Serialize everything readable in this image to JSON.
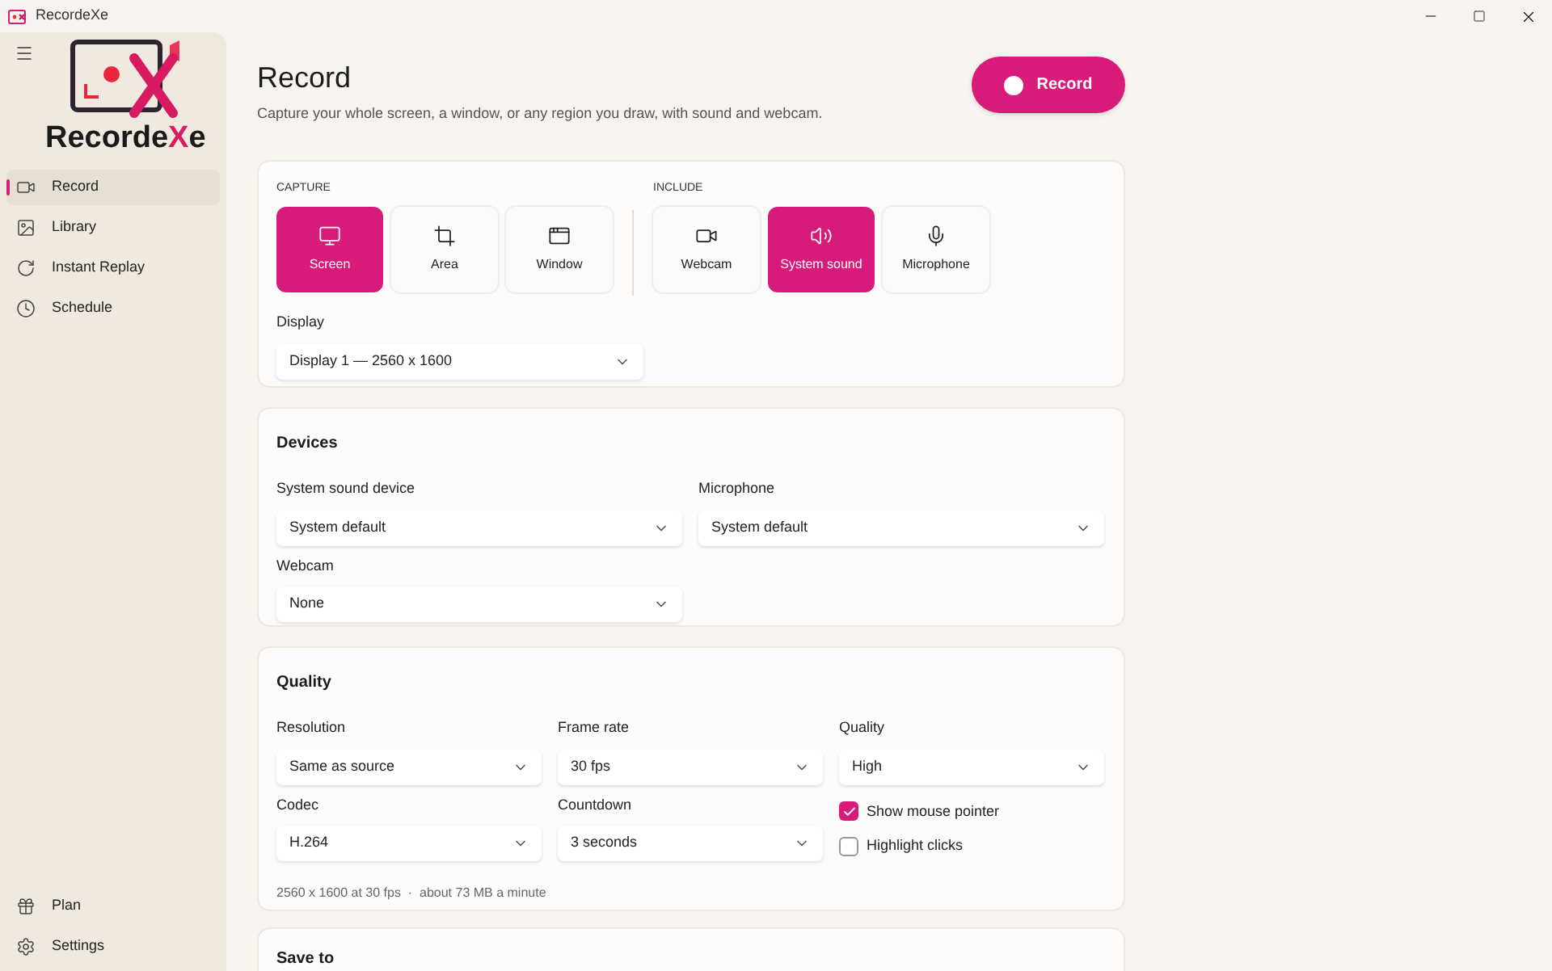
{
  "window": {
    "title": "RecordeXe"
  },
  "logo": {
    "name": "Recorde",
    "accent": "X",
    "suffix": "e"
  },
  "sidebar": {
    "items": [
      {
        "label": "Record",
        "kind": "video",
        "selected": true
      },
      {
        "label": "Library",
        "kind": "image",
        "selected": false
      },
      {
        "label": "Instant Replay",
        "kind": "replay",
        "selected": false
      },
      {
        "label": "Schedule",
        "kind": "clock",
        "selected": false
      }
    ],
    "footer_items": [
      {
        "label": "Plan",
        "kind": "gift",
        "selected": false
      },
      {
        "label": "Settings",
        "kind": "settings",
        "selected": false
      }
    ]
  },
  "header": {
    "title": "Record",
    "subtitle": "Capture your whole screen, a window, or any region you draw, with sound and webcam.",
    "record_button": "Record"
  },
  "capture": {
    "heading": "CAPTURE",
    "options": [
      {
        "label": "Screen",
        "kind": "monitor",
        "selected": true
      },
      {
        "label": "Area",
        "kind": "crop",
        "selected": false
      },
      {
        "label": "Window",
        "kind": "window",
        "selected": false
      }
    ]
  },
  "include": {
    "heading": "INCLUDE",
    "options": [
      {
        "label": "Webcam",
        "kind": "video",
        "selected": false
      },
      {
        "label": "System sound",
        "kind": "speaker",
        "selected": true
      },
      {
        "label": "Microphone",
        "kind": "mic",
        "selected": false
      }
    ]
  },
  "display": {
    "label": "Display",
    "value": "Display 1 — 2560 x 1600"
  },
  "devices": {
    "title": "Devices",
    "fields": [
      {
        "label": "System sound device",
        "value": "System default"
      },
      {
        "label": "Microphone",
        "value": "System default"
      },
      {
        "label": "Webcam",
        "value": "None"
      }
    ]
  },
  "quality": {
    "title": "Quality",
    "fields": [
      {
        "label": "Resolution",
        "value": "Same as source"
      },
      {
        "label": "Frame rate",
        "value": "30 fps"
      },
      {
        "label": "Quality",
        "value": "High"
      },
      {
        "label": "Codec",
        "value": "H.264"
      },
      {
        "label": "Countdown",
        "value": "3 seconds"
      }
    ],
    "checkboxes": [
      {
        "label": "Show mouse pointer",
        "checked": true
      },
      {
        "label": "Highlight clicks",
        "checked": false
      }
    ],
    "summary": "2560 x 1600 at 30 fps  ·  about 73 MB a minute"
  },
  "save_to": {
    "title": "Save to"
  }
}
